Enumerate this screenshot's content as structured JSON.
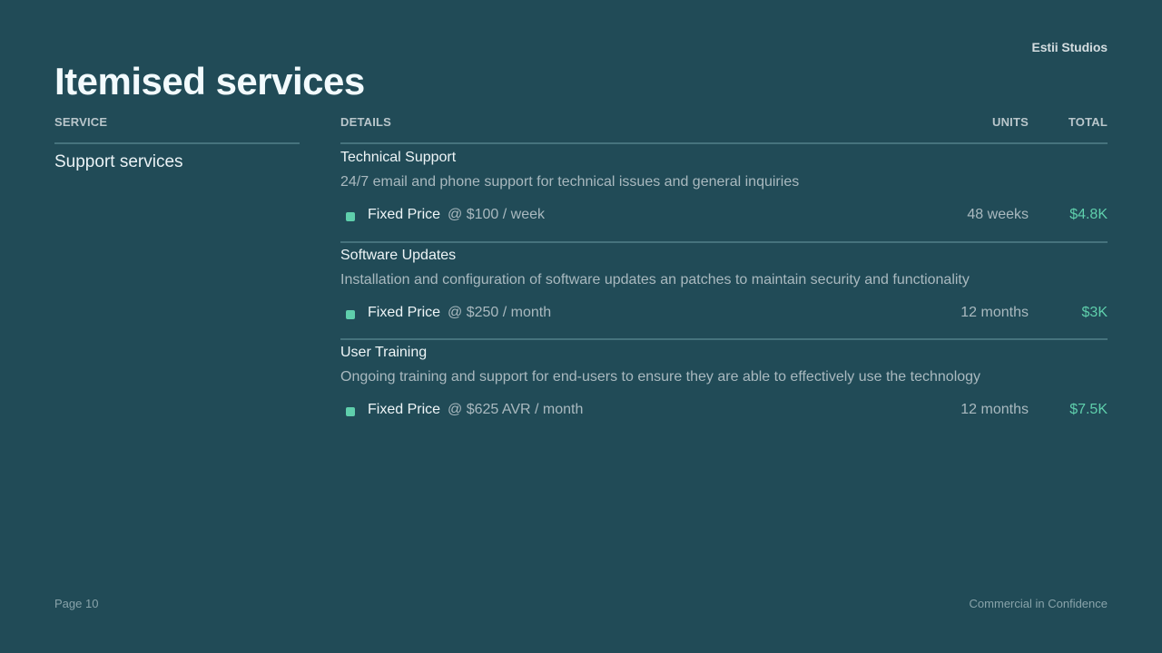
{
  "header": {
    "brand": "Estii Studios",
    "title": "Itemised services"
  },
  "columns": {
    "service": "SERVICE",
    "details": "DETAILS",
    "units": "UNITS",
    "total": "TOTAL"
  },
  "service": {
    "name": "Support services"
  },
  "items": [
    {
      "name": "Technical Support",
      "description": "24/7 email and phone support for technical issues and general inquiries",
      "price_type": "Fixed Price",
      "rate": "@ $100 / week",
      "units": "48 weeks",
      "total": "$4.8K"
    },
    {
      "name": "Software Updates",
      "description": "Installation and configuration of software updates an patches to maintain security and functionality",
      "price_type": "Fixed Price",
      "rate": "@ $250 / month",
      "units": "12 months",
      "total": "$3K"
    },
    {
      "name": "User Training",
      "description": "Ongoing training and support for end-users to ensure they are able to effectively use the technology",
      "price_type": "Fixed Price",
      "rate": "@ $625 AVR / month",
      "units": "12 months",
      "total": "$7.5K"
    }
  ],
  "colors": {
    "background": "#214b57",
    "accent": "#5fcfac",
    "divider": "#46737d"
  },
  "footer": {
    "page": "Page 10",
    "confidentiality": "Commercial in Confidence"
  }
}
